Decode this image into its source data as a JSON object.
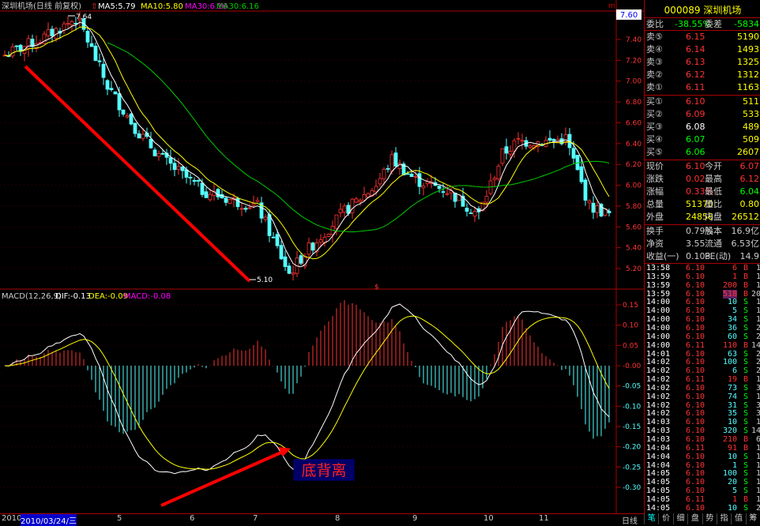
{
  "header": {
    "title": "深圳机场(日线 前复权)",
    "ma5": "MA5:5.79",
    "ma10": "MA10:5.80",
    "ma30": "MA30:6.16",
    "ma60": "MA30:6.16",
    "last_price_tag": "7.60",
    "corner_mark": "m"
  },
  "colors": {
    "up": "#ff3232",
    "down": "#54ffff",
    "ma5": "#ffffff",
    "ma10": "#ffff00",
    "ma30": "#ff00ff",
    "ma60": "#00cc00",
    "grid": "#8b0000",
    "annotation": "#ff0000",
    "label_yellow": "#ffff00"
  },
  "price_axis": {
    "labels": [
      "7.40",
      "7.20",
      "7.00",
      "6.80",
      "6.60",
      "6.40",
      "6.20",
      "6.00",
      "5.80",
      "5.60",
      "5.40",
      "5.20"
    ],
    "max_label": "7.64",
    "min_label": "5.10"
  },
  "macd": {
    "title": "MACD(12,26,9)",
    "dif": "DIF:-0.13",
    "dea": "DEA:-0.09",
    "macd": "MACD:-0.08",
    "axis_labels": [
      "0.15",
      "0.10",
      "0.05",
      "-0.00",
      "-0.05",
      "-0.10",
      "-0.15",
      "-0.20",
      "-0.25",
      "-0.30"
    ],
    "annotation": "底背离"
  },
  "time_axis": {
    "start_year": "2010",
    "cursor_date": "2010/03/24/三",
    "months": [
      "5",
      "6",
      "7",
      "8",
      "9",
      "10",
      "11"
    ],
    "period": "日线"
  },
  "quote": {
    "code": "000089",
    "name": "深圳机场",
    "ratio_label": "委比",
    "ratio_value": "-38.55%",
    "diff_label": "委差",
    "diff_value": "-5834",
    "sell": [
      {
        "label": "卖⑤",
        "price": "6.15",
        "vol": "5190"
      },
      {
        "label": "卖④",
        "price": "6.14",
        "vol": "1493"
      },
      {
        "label": "卖③",
        "price": "6.13",
        "vol": "1325"
      },
      {
        "label": "卖②",
        "price": "6.12",
        "vol": "1312"
      },
      {
        "label": "卖①",
        "price": "6.11",
        "vol": "1163"
      }
    ],
    "buy": [
      {
        "label": "买①",
        "price": "6.10",
        "vol": "511"
      },
      {
        "label": "买②",
        "price": "6.09",
        "vol": "533"
      },
      {
        "label": "买③",
        "price": "6.08",
        "vol": "489"
      },
      {
        "label": "买④",
        "price": "6.07",
        "vol": "509"
      },
      {
        "label": "买⑤",
        "price": "6.06",
        "vol": "2607"
      }
    ],
    "stats": [
      {
        "l1": "现价",
        "v1": "6.10",
        "l2": "今开",
        "v2": "6.07"
      },
      {
        "l1": "涨跌",
        "v1": "0.02",
        "l2": "最高",
        "v2": "6.12"
      },
      {
        "l1": "涨幅",
        "v1": "0.33%",
        "l2": "最低",
        "v2": "6.04"
      },
      {
        "l1": "总量",
        "v1": "51370",
        "l2": "量比",
        "v2": "0.80"
      },
      {
        "l1": "外盘",
        "v1": "24858",
        "l2": "内盘",
        "v2": "26512"
      }
    ],
    "stats2": [
      {
        "l1": "换手",
        "v1": "0.79%",
        "l2": "股本",
        "v2": "16.9亿"
      },
      {
        "l1": "净资",
        "v1": "3.55",
        "l2": "流通",
        "v2": "6.53亿"
      },
      {
        "l1": "收益(一)",
        "v1": "0.103",
        "l2": "PE(动)",
        "v2": "14.9"
      }
    ]
  },
  "ticks": [
    {
      "time": "13:58",
      "price": "6.10",
      "vol": "6",
      "side": "B",
      "n": "1"
    },
    {
      "time": "13:59",
      "price": "6.10",
      "vol": "1",
      "side": "B",
      "n": "1"
    },
    {
      "time": "13:59",
      "price": "6.10",
      "vol": "200",
      "side": "B",
      "n": "1"
    },
    {
      "time": "13:59",
      "price": "6.10",
      "vol": "518",
      "side": "B",
      "n": "20"
    },
    {
      "time": "14:00",
      "price": "6.10",
      "vol": "10",
      "side": "S",
      "n": "1"
    },
    {
      "time": "14:00",
      "price": "6.10",
      "vol": "5",
      "side": "S",
      "n": "1"
    },
    {
      "time": "14:00",
      "price": "6.10",
      "vol": "34",
      "side": "S",
      "n": "1"
    },
    {
      "time": "14:00",
      "price": "6.10",
      "vol": "36",
      "side": "S",
      "n": "2"
    },
    {
      "time": "14:00",
      "price": "6.10",
      "vol": "60",
      "side": "S",
      "n": "2"
    },
    {
      "time": "14:00",
      "price": "6.11",
      "vol": "110",
      "side": "B",
      "n": "14"
    },
    {
      "time": "14:01",
      "price": "6.10",
      "vol": "63",
      "side": "S",
      "n": "2"
    },
    {
      "time": "14:02",
      "price": "6.10",
      "vol": "100",
      "side": "S",
      "n": "2"
    },
    {
      "time": "14:02",
      "price": "6.10",
      "vol": "6",
      "side": "S",
      "n": "2"
    },
    {
      "time": "14:02",
      "price": "6.11",
      "vol": "19",
      "side": "B",
      "n": "1"
    },
    {
      "time": "14:02",
      "price": "6.10",
      "vol": "73",
      "side": "S",
      "n": "3"
    },
    {
      "time": "14:02",
      "price": "6.10",
      "vol": "74",
      "side": "S",
      "n": "1"
    },
    {
      "time": "14:02",
      "price": "6.10",
      "vol": "31",
      "side": "S",
      "n": "3"
    },
    {
      "time": "14:02",
      "price": "6.10",
      "vol": "35",
      "side": "S",
      "n": "3"
    },
    {
      "time": "14:03",
      "price": "6.10",
      "vol": "10",
      "side": "S",
      "n": "1"
    },
    {
      "time": "14:03",
      "price": "6.10",
      "vol": "320",
      "side": "S",
      "n": "14"
    },
    {
      "time": "14:03",
      "price": "6.10",
      "vol": "210",
      "side": "B",
      "n": "6"
    },
    {
      "time": "14:04",
      "price": "6.11",
      "vol": "91",
      "side": "B",
      "n": "1"
    },
    {
      "time": "14:04",
      "price": "6.10",
      "vol": "10",
      "side": "S",
      "n": "1"
    },
    {
      "time": "14:04",
      "price": "6.10",
      "vol": "1",
      "side": "S",
      "n": "1"
    },
    {
      "time": "14:05",
      "price": "6.10",
      "vol": "100",
      "side": "S",
      "n": "1"
    },
    {
      "time": "14:05",
      "price": "6.10",
      "vol": "20",
      "side": "S",
      "n": "1"
    },
    {
      "time": "14:05",
      "price": "6.10",
      "vol": "5",
      "side": "S",
      "n": "1"
    },
    {
      "time": "14:05",
      "price": "6.11",
      "vol": "1",
      "side": "B",
      "n": "1"
    },
    {
      "time": "14:05",
      "price": "6.10",
      "vol": "10",
      "side": "S",
      "n": "2"
    }
  ],
  "tabs": [
    "笔",
    "价",
    "细",
    "盘",
    "势",
    "指",
    "值",
    "筹"
  ]
}
